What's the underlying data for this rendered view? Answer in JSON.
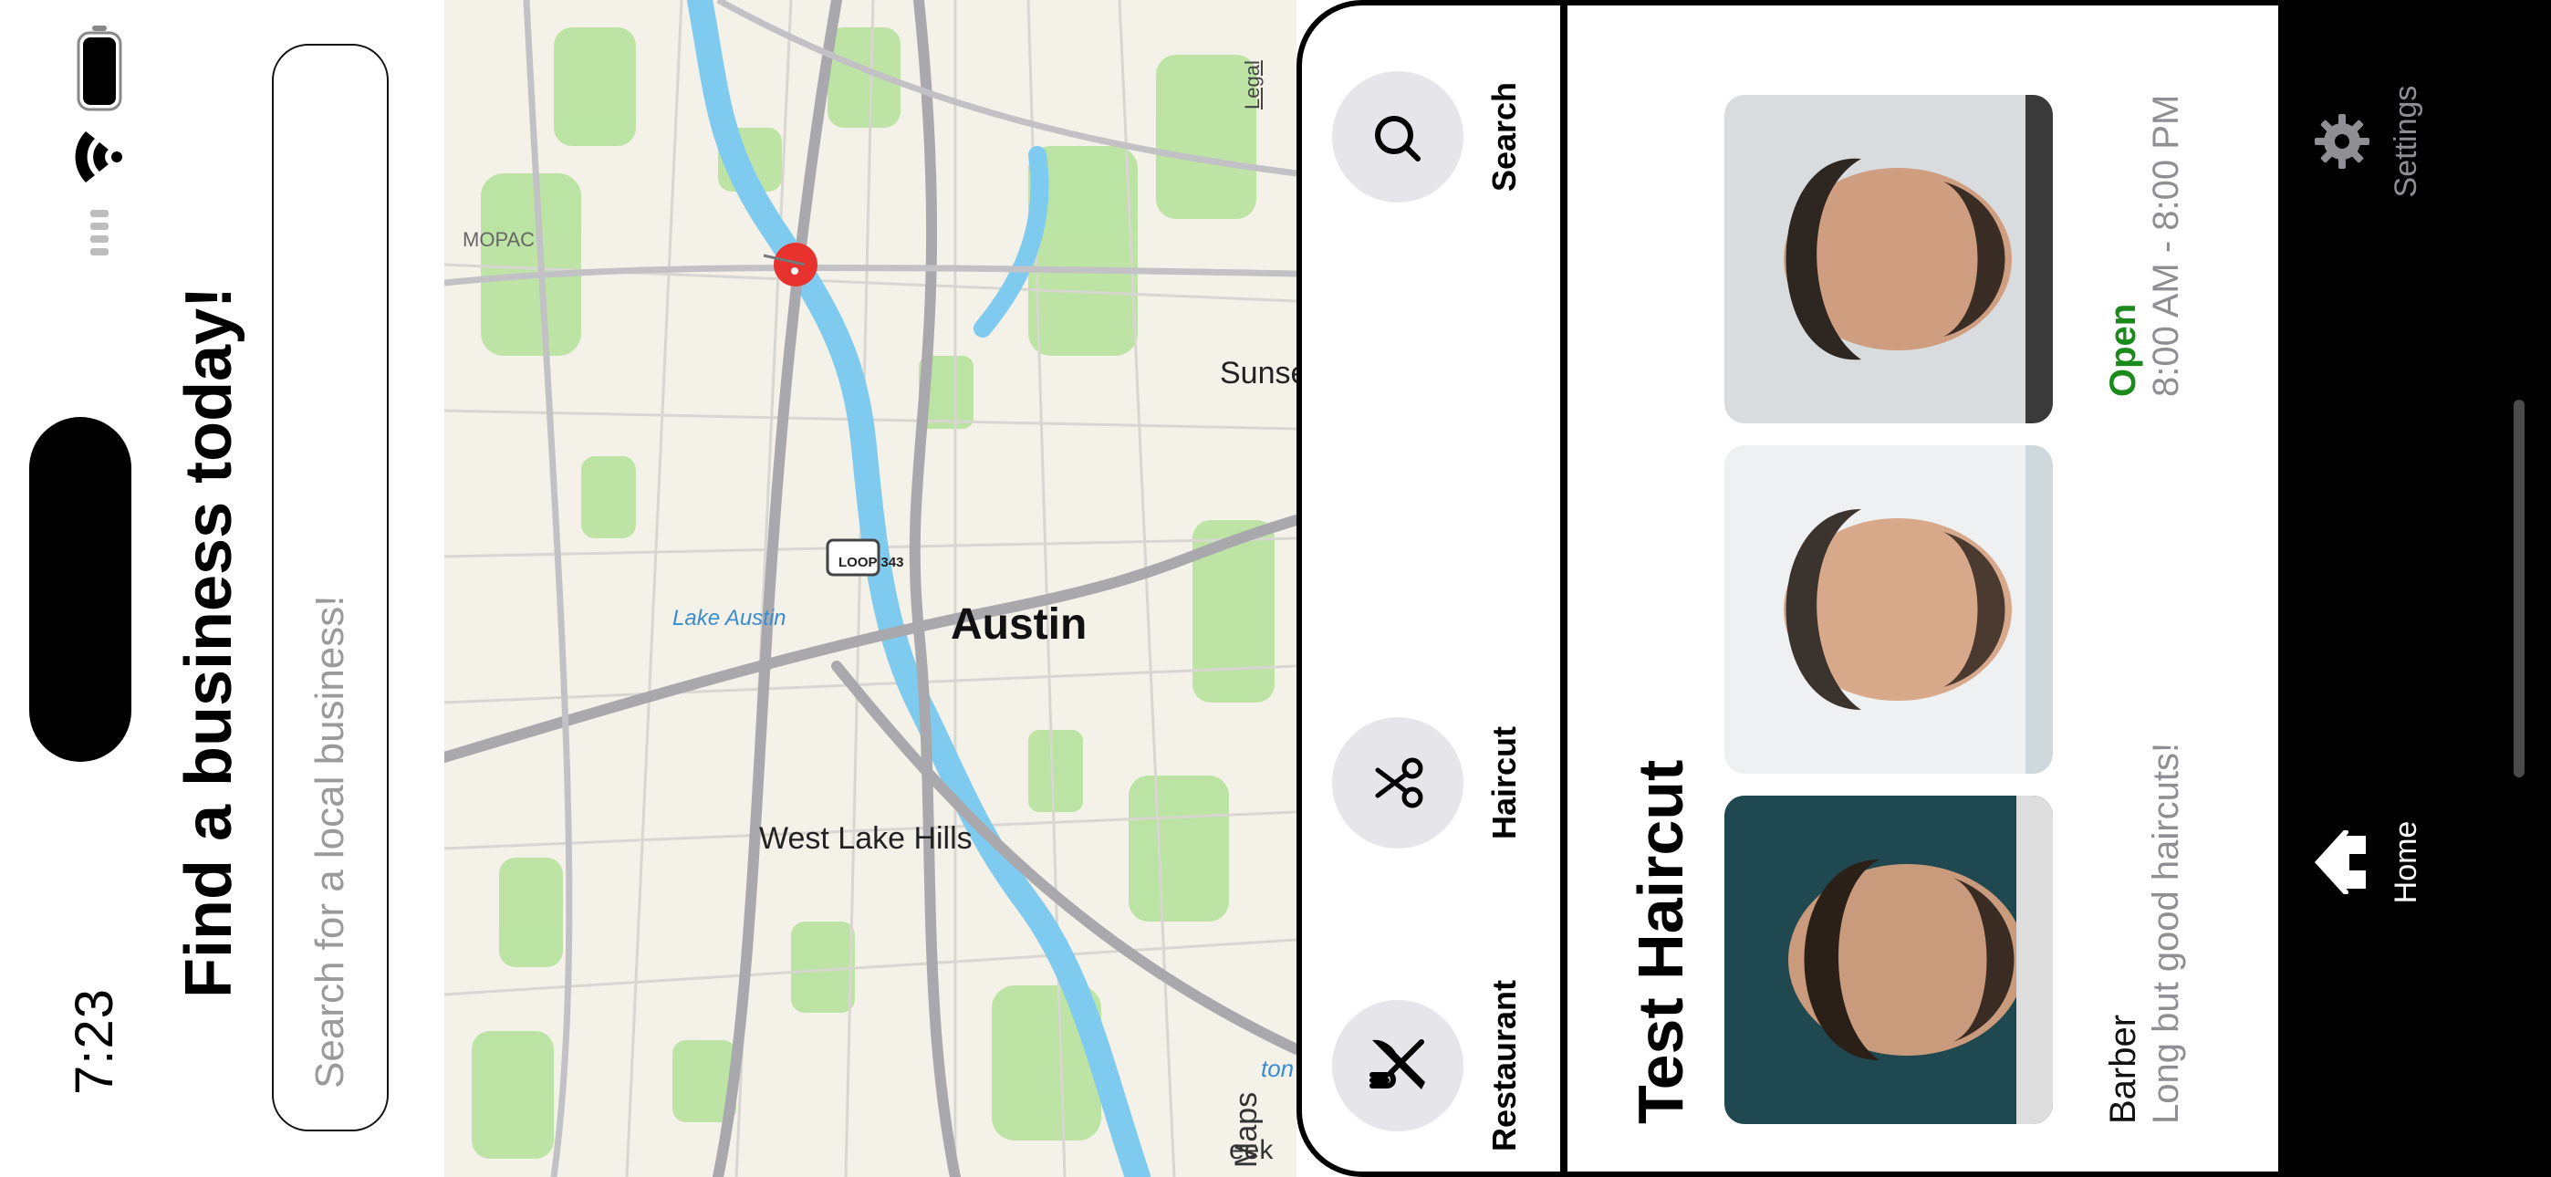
{
  "status_bar": {
    "time": "7:23"
  },
  "headline": "Find a business today!",
  "search": {
    "placeholder": "Search for a local business!"
  },
  "map": {
    "city_label": "Austin",
    "place_labels": [
      "West Lake Hills",
      "Sunset Valley",
      "Lake Austin",
      "MOPAC",
      "LOOP 343",
      "ton Creek",
      "eek"
    ],
    "attribution": "Maps",
    "legal": "Legal"
  },
  "categories": [
    {
      "label": "Restaurant",
      "icon": "fork-knife-icon"
    },
    {
      "label": "Haircut",
      "icon": "scissors-icon"
    },
    {
      "label": "Search",
      "icon": "search-icon"
    }
  ],
  "business": {
    "name": "Test Haircut",
    "type": "Barber",
    "description": "Long but good haircuts!",
    "status": "Open",
    "hours": "8:00 AM - 8:00 PM"
  },
  "tabs": [
    {
      "label": "Home",
      "icon": "home-icon",
      "active": true
    },
    {
      "label": "Settings",
      "icon": "gear-icon",
      "active": false
    }
  ],
  "colors": {
    "open_status": "#1a8a1a",
    "pin": "#e8322e",
    "map_water": "#7fcbf0",
    "map_park": "#b9e3a0",
    "tab_active": "#ffffff",
    "tab_inactive": "#8e8e93"
  }
}
